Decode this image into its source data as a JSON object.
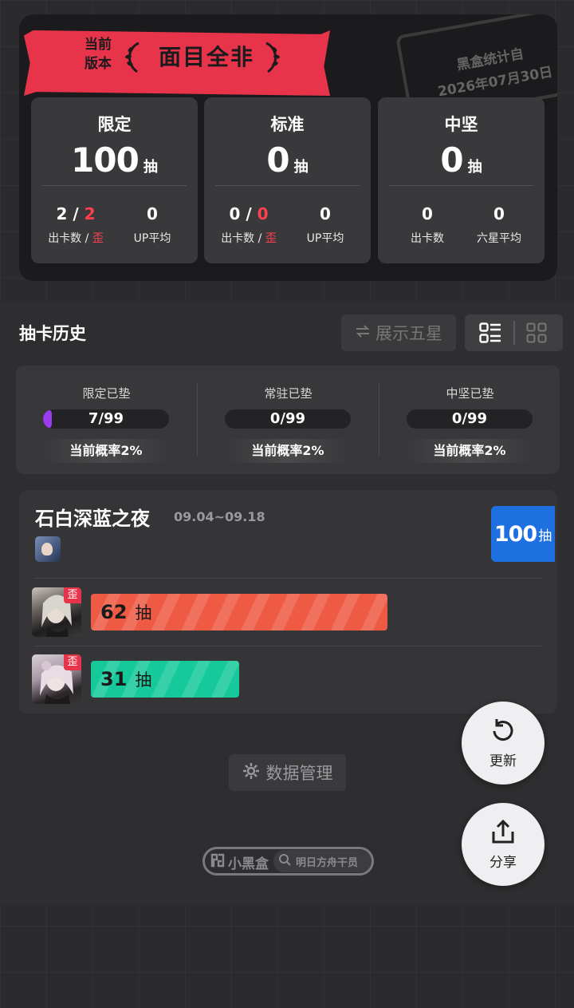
{
  "header": {
    "version_label_line1": "当前",
    "version_label_line2": "版本",
    "version_title": "面目全非",
    "stamp_line1": "黑盒统计自",
    "stamp_line2": "2026年07月30日"
  },
  "stats": [
    {
      "title": "限定",
      "total": "100",
      "unit": "抽",
      "left_value_a": "2",
      "left_value_sep": " / ",
      "left_value_b": "2",
      "left_label_a": "出卡数",
      "left_label_sep": " / ",
      "left_label_b": "歪",
      "right_value": "0",
      "right_label": "UP平均"
    },
    {
      "title": "标准",
      "total": "0",
      "unit": "抽",
      "left_value_a": "0",
      "left_value_sep": " / ",
      "left_value_b": "0",
      "left_label_a": "出卡数",
      "left_label_sep": " / ",
      "left_label_b": "歪",
      "right_value": "0",
      "right_label": "UP平均"
    },
    {
      "title": "中坚",
      "total": "0",
      "unit": "抽",
      "left_value_a": "0",
      "left_label_a": "出卡数",
      "right_value": "0",
      "right_label": "六星平均"
    }
  ],
  "history": {
    "title": "抽卡历史",
    "show_five_star_label": "展示五星"
  },
  "pity": [
    {
      "label": "限定已垫",
      "value": "7/99",
      "progress": 0.0707,
      "rate": "当前概率2%"
    },
    {
      "label": "常驻已垫",
      "value": "0/99",
      "progress": 0,
      "rate": "当前概率2%"
    },
    {
      "label": "中坚已垫",
      "value": "0/99",
      "progress": 0,
      "rate": "当前概率2%"
    }
  ],
  "banner": {
    "name": "石白深蓝之夜",
    "dates": "09.04~09.18",
    "total": "100",
    "total_unit": "抽",
    "pulls": [
      {
        "count": "62",
        "unit": "抽",
        "badge": "歪",
        "color": "#ee5a44",
        "fraction": 0.62
      },
      {
        "count": "31",
        "unit": "抽",
        "badge": "歪",
        "color": "#16c99a",
        "fraction": 0.31
      }
    ]
  },
  "footer": {
    "data_mgmt_label": "数据管理",
    "brand_name": "小黑盒",
    "brand_search": "明日方舟干员"
  },
  "fabs": {
    "refresh_label": "更新",
    "share_label": "分享"
  },
  "icons": [
    "laurel-left-icon",
    "laurel-right-icon",
    "swap-icon",
    "list-view-icon",
    "grid-view-icon",
    "gear-icon",
    "brand-logo-icon",
    "search-icon",
    "refresh-icon",
    "share-icon"
  ],
  "colors": {
    "accent_red": "#e8344a",
    "limited_blue": "#1e6fe0",
    "pity_purple": "#9b3cf0"
  }
}
